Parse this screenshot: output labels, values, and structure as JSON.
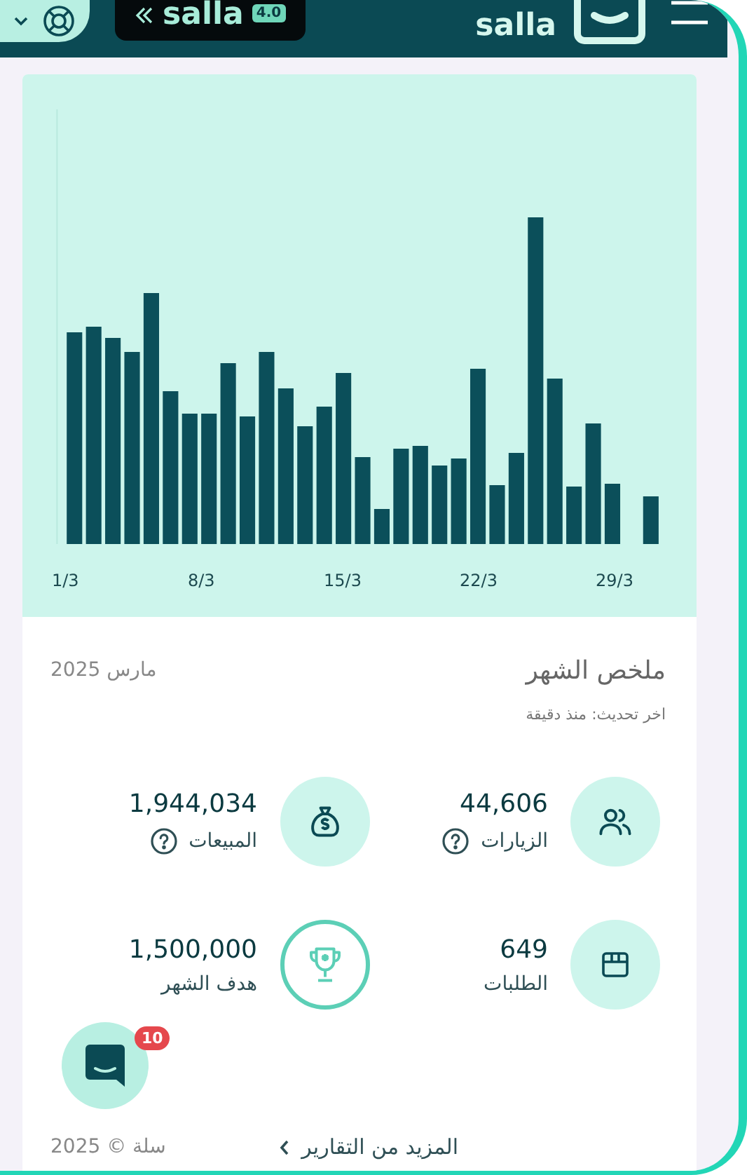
{
  "header": {
    "brand_badge": {
      "text": "salla",
      "version": "4.0"
    },
    "logo": {
      "text": "salla"
    }
  },
  "chart": {
    "x_labels": [
      "29/3",
      "22/3",
      "15/3",
      "8/3",
      "1/3"
    ]
  },
  "summary": {
    "title": "ملخص الشهر",
    "period": "مارس 2025",
    "updated": "اخر تحديث: منذ دقيقة"
  },
  "metrics": [
    {
      "kind": "visits",
      "value": "44,606",
      "label": "الزيارات",
      "help": true
    },
    {
      "kind": "sales",
      "value": "1,944,034",
      "label": "المبيعات",
      "help": true
    },
    {
      "kind": "orders",
      "value": "649",
      "label": "الطلبات",
      "help": false
    },
    {
      "kind": "goal",
      "value": "1,500,000",
      "label": "هدف الشهر",
      "help": false
    }
  ],
  "chat": {
    "badge": "10"
  },
  "footer": {
    "copyright": "سلة © 2025",
    "more_link": "المزيد من التقارير"
  }
}
